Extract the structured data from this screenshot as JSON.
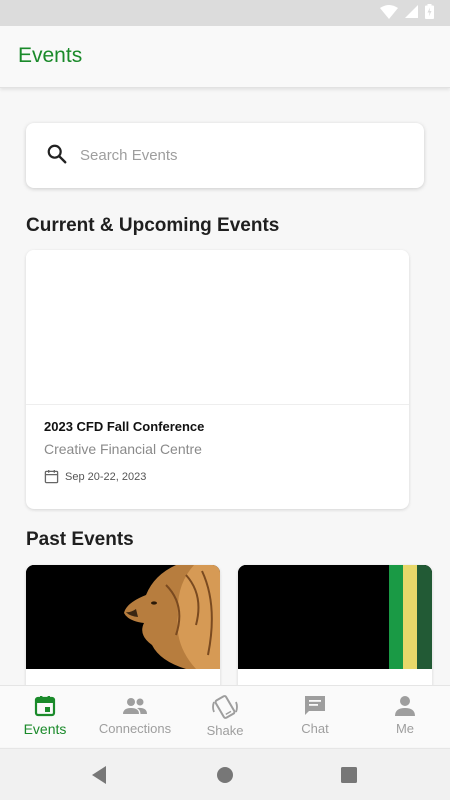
{
  "app": {
    "title": "Events"
  },
  "search": {
    "placeholder": "Search Events",
    "value": ""
  },
  "current_section": {
    "title": "Current & Upcoming Events"
  },
  "current_events": [
    {
      "name": "2023 CFD Fall Conference",
      "venue": "Creative Financial Centre",
      "date": "Sep 20-22, 2023"
    }
  ],
  "past_section": {
    "title": "Past Events"
  },
  "past_events": [
    {
      "thumbnail": "lion-image"
    },
    {
      "thumbnail": "green-yellow-stripes-image"
    }
  ],
  "bottom_nav": {
    "items": [
      {
        "label": "Events",
        "icon": "calendar-icon",
        "active": true
      },
      {
        "label": "Connections",
        "icon": "people-icon",
        "active": false
      },
      {
        "label": "Shake",
        "icon": "shake-icon",
        "active": false
      },
      {
        "label": "Chat",
        "icon": "chat-icon",
        "active": false
      },
      {
        "label": "Me",
        "icon": "person-icon",
        "active": false
      }
    ]
  },
  "colors": {
    "accent": "#1a8a2a",
    "inactive": "#9e9e9e"
  }
}
